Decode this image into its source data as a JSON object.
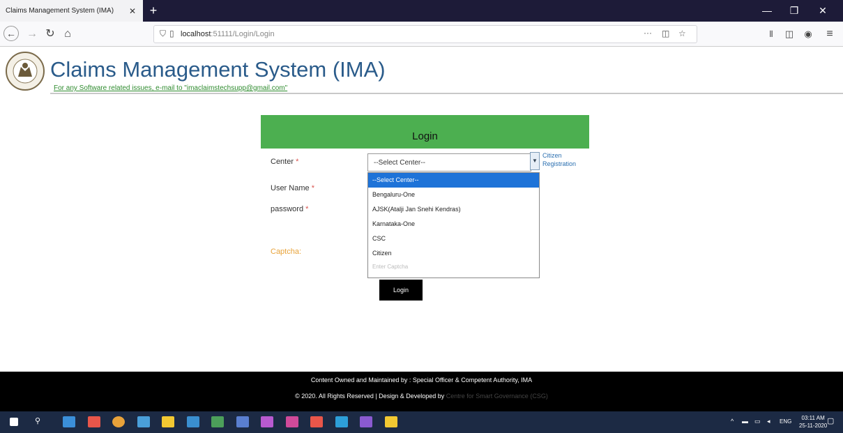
{
  "browser": {
    "tab_title": "Claims Management System (IMA)",
    "tab_close": "✕",
    "new_tab": "+",
    "url_host": "localhost",
    "url_rest": ":51111/Login/Login",
    "page_actions": "···"
  },
  "header": {
    "title": "Claims Management System (IMA)",
    "support_text": "For any Software related issues, e-mail to \"imaclaimstechsupp@gmail.com\""
  },
  "login": {
    "title": "Login",
    "center_label": "Center",
    "username_label": "User Name",
    "password_label": "password",
    "required_mark": "*",
    "captcha_label": "Captcha:",
    "select_value": "--Select Center--",
    "citizen_registration": "Citizen Registration",
    "options": [
      "--Select Center--",
      "Bengaluru-One",
      "AJSK(Atalji Jan Snehi Kendras)",
      "Karnataka-One",
      "CSC",
      "Citizen"
    ],
    "captcha_placeholder": "Enter Captcha",
    "button": "Login"
  },
  "footer": {
    "line1": "Content Owned and Maintained by : Special Officer & Competent Authority, IMA",
    "line2_prefix": "© 2020. All Rights Reserved | Design & Developed by",
    "line2_link": "Centre for Smart Governance (CSG)"
  },
  "taskbar": {
    "lang": "ENG",
    "time": "03:11 AM",
    "date": "25-11-2020"
  },
  "colors": {
    "login_header": "#4caf50",
    "title_blue": "#2a5b8a",
    "selected_option": "#1e73d8",
    "footer": "#000000"
  }
}
